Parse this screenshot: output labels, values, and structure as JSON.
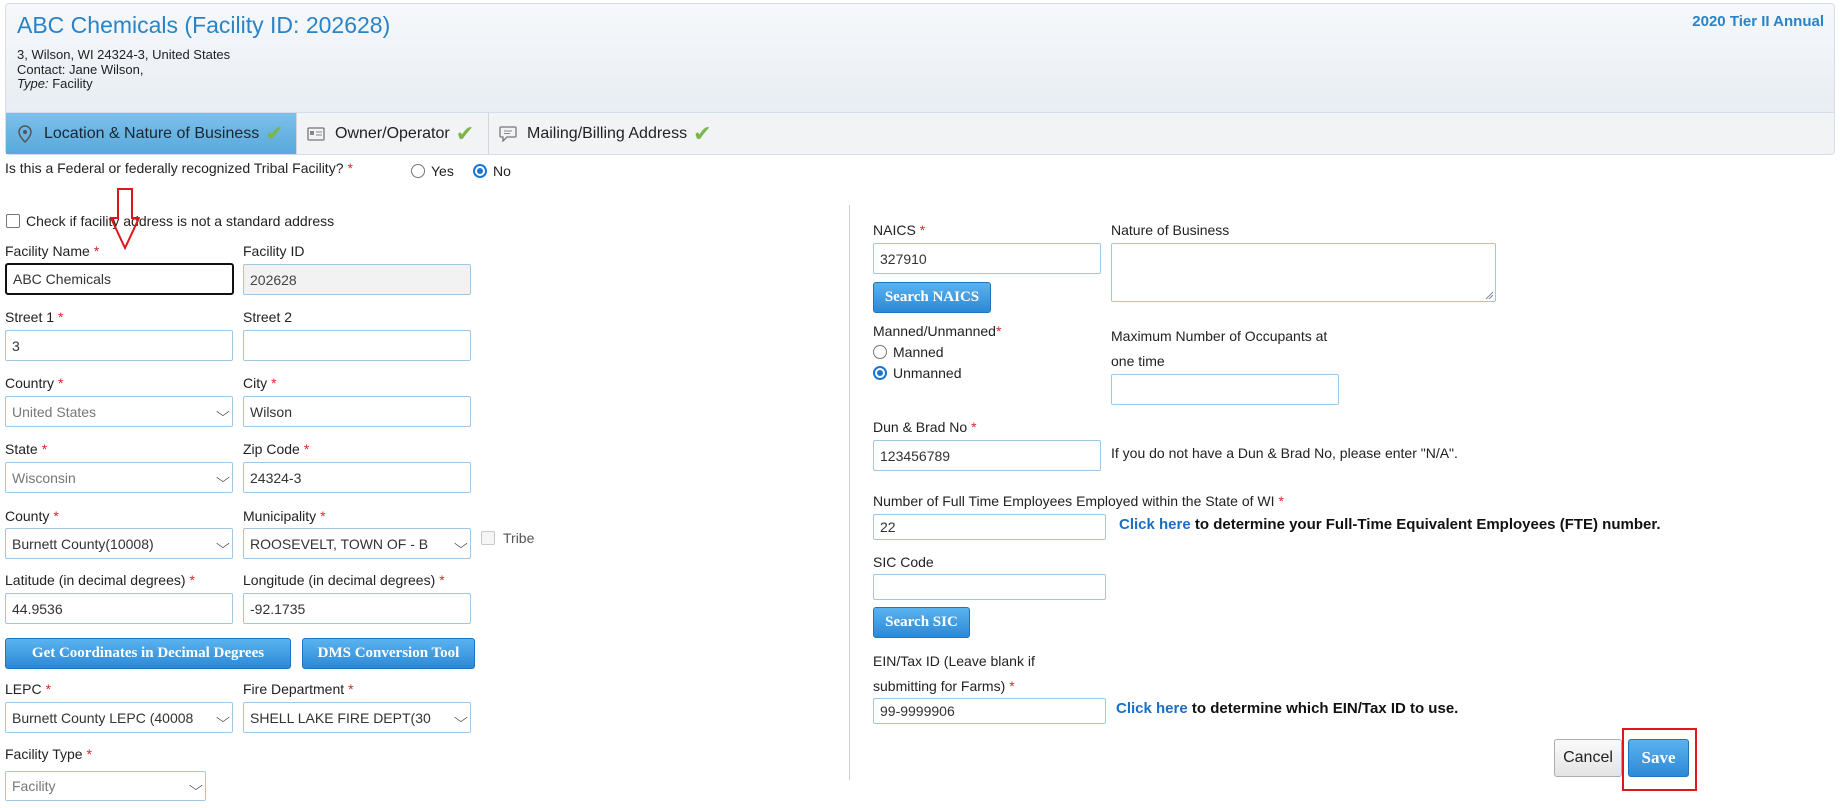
{
  "header": {
    "title": "ABC Chemicals (Facility ID: 202628)",
    "address": "3, Wilson, WI 24324-3, United States",
    "contact": "Contact: Jane Wilson,",
    "type_label": "Type:",
    "type_value": "Facility",
    "report": "2020 Tier II Annual"
  },
  "tabs": [
    {
      "label": "Location & Nature of Business",
      "icon": "location-pin-icon",
      "complete": true,
      "active": true
    },
    {
      "label": "Owner/Operator",
      "icon": "id-card-icon",
      "complete": true,
      "active": false
    },
    {
      "label": "Mailing/Billing Address",
      "icon": "speech-bubble-icon",
      "complete": true,
      "active": false
    }
  ],
  "federal": {
    "question": "Is this a Federal or federally recognized Tribal Facility?",
    "yes": "Yes",
    "no": "No",
    "selected": "No"
  },
  "nonstandard_address": {
    "label": "Check if facility address is not a standard address",
    "checked": false
  },
  "left": {
    "facility_name": {
      "label": "Facility Name",
      "value": "ABC Chemicals"
    },
    "facility_id": {
      "label": "Facility ID",
      "value": "202628"
    },
    "street1": {
      "label": "Street 1",
      "value": "3"
    },
    "street2": {
      "label": "Street 2",
      "value": ""
    },
    "country": {
      "label": "Country",
      "value": "United States"
    },
    "city": {
      "label": "City",
      "value": "Wilson"
    },
    "state": {
      "label": "State",
      "value": "Wisconsin"
    },
    "zip": {
      "label": "Zip Code",
      "value": "24324-3"
    },
    "county": {
      "label": "County",
      "value": "Burnett County(10008)"
    },
    "municipality": {
      "label": "Municipality",
      "value": "ROOSEVELT, TOWN OF - B"
    },
    "tribe": {
      "label": "Tribe",
      "checked": false
    },
    "latitude": {
      "label": "Latitude (in decimal degrees)",
      "value": "44.9536"
    },
    "longitude": {
      "label": "Longitude (in decimal degrees)",
      "value": "-92.1735"
    },
    "get_coords_button": "Get Coordinates in Decimal Degrees",
    "dms_button": "DMS Conversion Tool",
    "lepc": {
      "label": "LEPC",
      "value": "Burnett County LEPC (40008"
    },
    "fire_dept": {
      "label": "Fire Department",
      "value": "SHELL LAKE FIRE DEPT(30"
    },
    "facility_type": {
      "label": "Facility Type",
      "value": "Facility"
    }
  },
  "right": {
    "naics": {
      "label": "NAICS",
      "value": "327910"
    },
    "search_naics_button": "Search NAICS",
    "nature_of_business": {
      "label": "Nature of Business",
      "value": ""
    },
    "manned": {
      "label": "Manned/Unmanned",
      "option_manned": "Manned",
      "option_unmanned": "Unmanned",
      "selected": "Unmanned"
    },
    "max_occupants": {
      "label_line1": "Maximum Number of Occupants at",
      "label_line2": "one time",
      "value": ""
    },
    "duns": {
      "label": "Dun & Brad No",
      "value": "123456789",
      "help": "If you do not have a Dun & Brad No, please enter \"N/A\"."
    },
    "employees": {
      "label": "Number of Full Time Employees Employed within the State of WI",
      "value": "22",
      "link": "Click here",
      "help": "to determine your Full-Time Equivalent Employees (FTE) number."
    },
    "sic": {
      "label": "SIC Code",
      "value": ""
    },
    "search_sic_button": "Search SIC",
    "ein": {
      "label_line1": "EIN/Tax ID (Leave blank if",
      "label_line2": "submitting for Farms)",
      "value": "99-9999906",
      "link": "Click here",
      "help": "to determine which EIN/Tax ID to use."
    }
  },
  "footer": {
    "cancel": "Cancel",
    "save": "Save"
  },
  "colors": {
    "accent": "#2a83c6",
    "required": "#d9262a",
    "check": "#7ab648",
    "annotation": "#e0161b"
  }
}
